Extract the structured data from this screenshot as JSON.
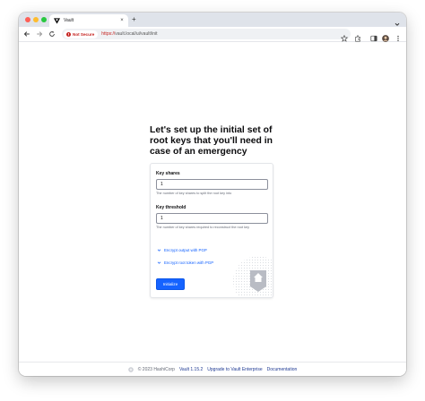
{
  "browser": {
    "tab_title": "Vault",
    "tab_close": "×",
    "new_tab": "+",
    "security_chip": "Not Secure",
    "url_scheme": "https://",
    "url_rest": "vault.local/ui/vault/init"
  },
  "page": {
    "heading": "Let's set up the initial set of root keys that you'll need in case of an emergency",
    "key_shares": {
      "label": "Key shares",
      "value": "1",
      "help": "The number of key shares to split the root key into"
    },
    "key_threshold": {
      "label": "Key threshold",
      "value": "1",
      "help": "The number of key shares required to reconstruct the root key"
    },
    "encrypt_output_label": "Encrypt output with PGP",
    "encrypt_root_label": "Encrypt root token with PGP",
    "initialize_label": "Initialize"
  },
  "footer": {
    "copyright": "© 2023 HashiCorp",
    "version": "Vault 1.15.2",
    "upgrade": "Upgrade to Vault Enterprise",
    "documentation": "Documentation"
  },
  "colors": {
    "primary": "#1563ff",
    "link": "#1060ff",
    "not_secure": "#c5221f"
  }
}
